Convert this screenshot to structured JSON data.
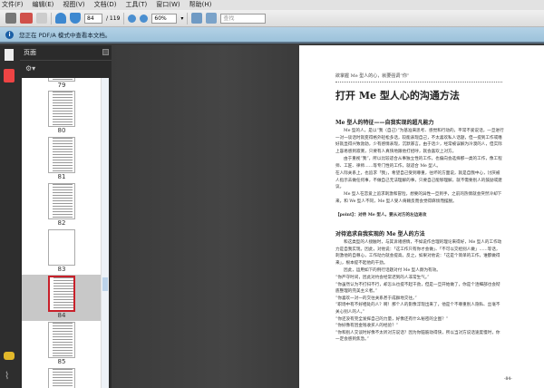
{
  "menu": [
    "文件(F)",
    "编辑(E)",
    "视图(V)",
    "文档(D)",
    "工具(T)",
    "窗口(W)",
    "帮助(H)"
  ],
  "toolbar": {
    "page_current": "84",
    "page_total": "/ 119",
    "zoom": "60%",
    "search_placeholder": "查找"
  },
  "infobar": {
    "message": "您正在 PDF/A 模式中查看本文档。"
  },
  "panel": {
    "title": "页面"
  },
  "thumbnails": [
    "79",
    "80",
    "81",
    "82",
    "83",
    "84",
    "85"
  ],
  "selected_page": "84",
  "doc": {
    "running_header": "欲掌握 Me 型人的心，就要强调“你”",
    "title": "打开 Me 型人心的沟通方法",
    "section1": "Me 型人的特征——自我实现的超凡能力",
    "p1": "Me 型的人，是以“我（自己）”为基准来思考、感觉和行动的，平常不爱说话，一旦进行一对一谈话时就变得格外轻松多话，较能表现自己，不太喜欢私人话题，但一提到工作或嗜好就显得兴致勃勃，少有感情表现，沉默寡言。由于话少，经常被误解为冷漠的人，但实际上容易感到寂寞，只要有人真快地跟他打招呼，就会喜欢上对方。",
    "p2": "由于重视“我”，所以比较适合从事独立性的工作，也偏向会选择那一类的工作，像工程师、工匠、律师……等专门性的工作，就适合 Me 型人。",
    "p3": "在人际关系上，也追求「我」，希望自己受到尊重，往坏的方面说，就是自我中心，讨厌被人指示去做任何事，不做自己无法理解的事，只要自己能够理解，就不需要别人的鼓励或建议。",
    "p4": "Me 型人在恋爱上追求刺激和冒险，想要的异性一旦到手，之前的热情就会突然冷却下来，和 We 型人不同，Me 型人受人倚赖反而会觉得麻烦而摆脱。",
    "point": "【point】：对待 Me 型人，要从对方的左边进攻",
    "section2": "对待追求自我实现的 Me 型人的方法",
    "p5": "和这类型的人接触时，与其诉诸感情，不如说作合理的理论来得好，Me 型人的工作动力是自我实现，因此，对他说：「这工作只有你才会做」、「不可以交给别人做」……等话，刺激他的自尊心，工作动力就会提高。反之，如果对他说：「这是个简单的工作，谁都做得来」，根本提不起他的干劲。",
    "p6": "因此，运用如下的例行话题对付 Me 型人颇为有效。",
    "quotes": [
      "“你严守时间，因此对约会经常迟到的人非常生气。”",
      "“你虽然认为不打扫不行，却怎么也提不起干劲，但是一旦开始做了，你是个连细部也会彻底整理的完美主义者。”",
      "“你喜欢一对一的交往关系甚于成群地交往。”",
      "“职场中有不好相处的人？啊！那个人的影像浮现出来了，他是个不尊重别人隐私、丝毫不关心别人的人。”",
      "“你还没有完全发挥自己的力量，好像还有什么秘密的企图？”",
      "“你好像有因金钱收买人的经验？”",
      "“你和别人交谈时好像不太听对方说话？因为你脑筋动得快，所以当对方说话速度慢时，你一定会感到焦急。”"
    ],
    "page_number": "-84-"
  }
}
